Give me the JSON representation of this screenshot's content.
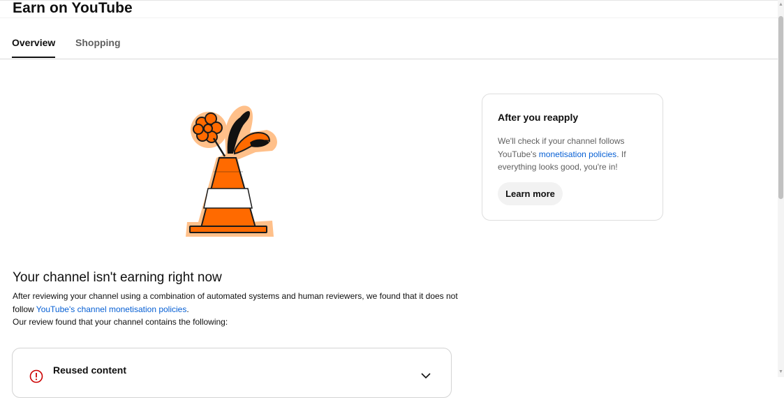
{
  "header": {
    "title": "Earn on YouTube",
    "tabs": [
      {
        "label": "Overview",
        "active": true
      },
      {
        "label": "Shopping",
        "active": false
      }
    ]
  },
  "main": {
    "heading": "Your channel isn't earning right now",
    "desc_part1": "After reviewing your channel using a combination of automated systems and human reviewers, we found that it does not follow ",
    "desc_link": "YouTube's channel monetisation policies",
    "desc_part2": ".",
    "desc_line2": "Our review found that your channel contains the following:",
    "issue": {
      "title": "Reused content",
      "icon": "error-icon",
      "expand_icon": "chevron-down-icon"
    }
  },
  "side_card": {
    "title": "After you reapply",
    "text_part1": "We'll check if your channel follows YouTube's ",
    "text_link": "monetisation policies",
    "text_part2": ". If everything looks good, you're in!",
    "button_label": "Learn more"
  },
  "colors": {
    "accent_link": "#065fd4",
    "cone_orange": "#ff6a00",
    "cone_outline_glow": "#ffc08a",
    "error_red": "#cc0000"
  }
}
